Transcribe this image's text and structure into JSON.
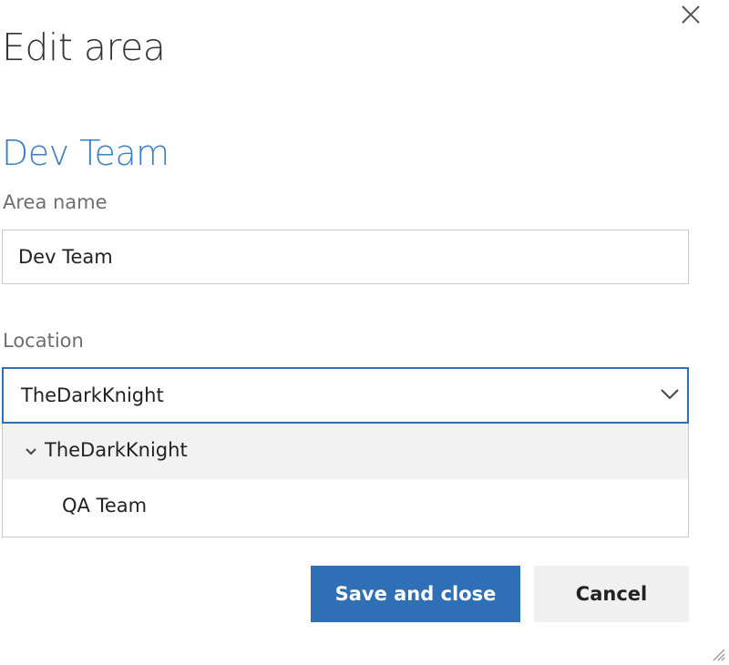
{
  "dialog": {
    "title": "Edit area",
    "area_heading": "Dev Team"
  },
  "form": {
    "area_name_label": "Area name",
    "area_name_value": "Dev Team",
    "location_label": "Location",
    "location_value": "TheDarkKnight"
  },
  "dropdown": {
    "items": [
      {
        "label": "TheDarkKnight",
        "expanded": true,
        "highlighted": true
      },
      {
        "label": "QA Team",
        "expanded": false,
        "highlighted": false
      }
    ]
  },
  "buttons": {
    "save_label": "Save and close",
    "cancel_label": "Cancel"
  },
  "icons": {
    "close": "close-icon",
    "select_chevron": "chevron-down-icon",
    "tree_expander": "chevron-down-icon",
    "resize": "resize-grip-icon"
  },
  "colors": {
    "accent": "#2e6fb5",
    "heading": "#3a7fc4",
    "highlight_row": "#f2f2f2",
    "secondary_button": "#f0f0f0"
  }
}
